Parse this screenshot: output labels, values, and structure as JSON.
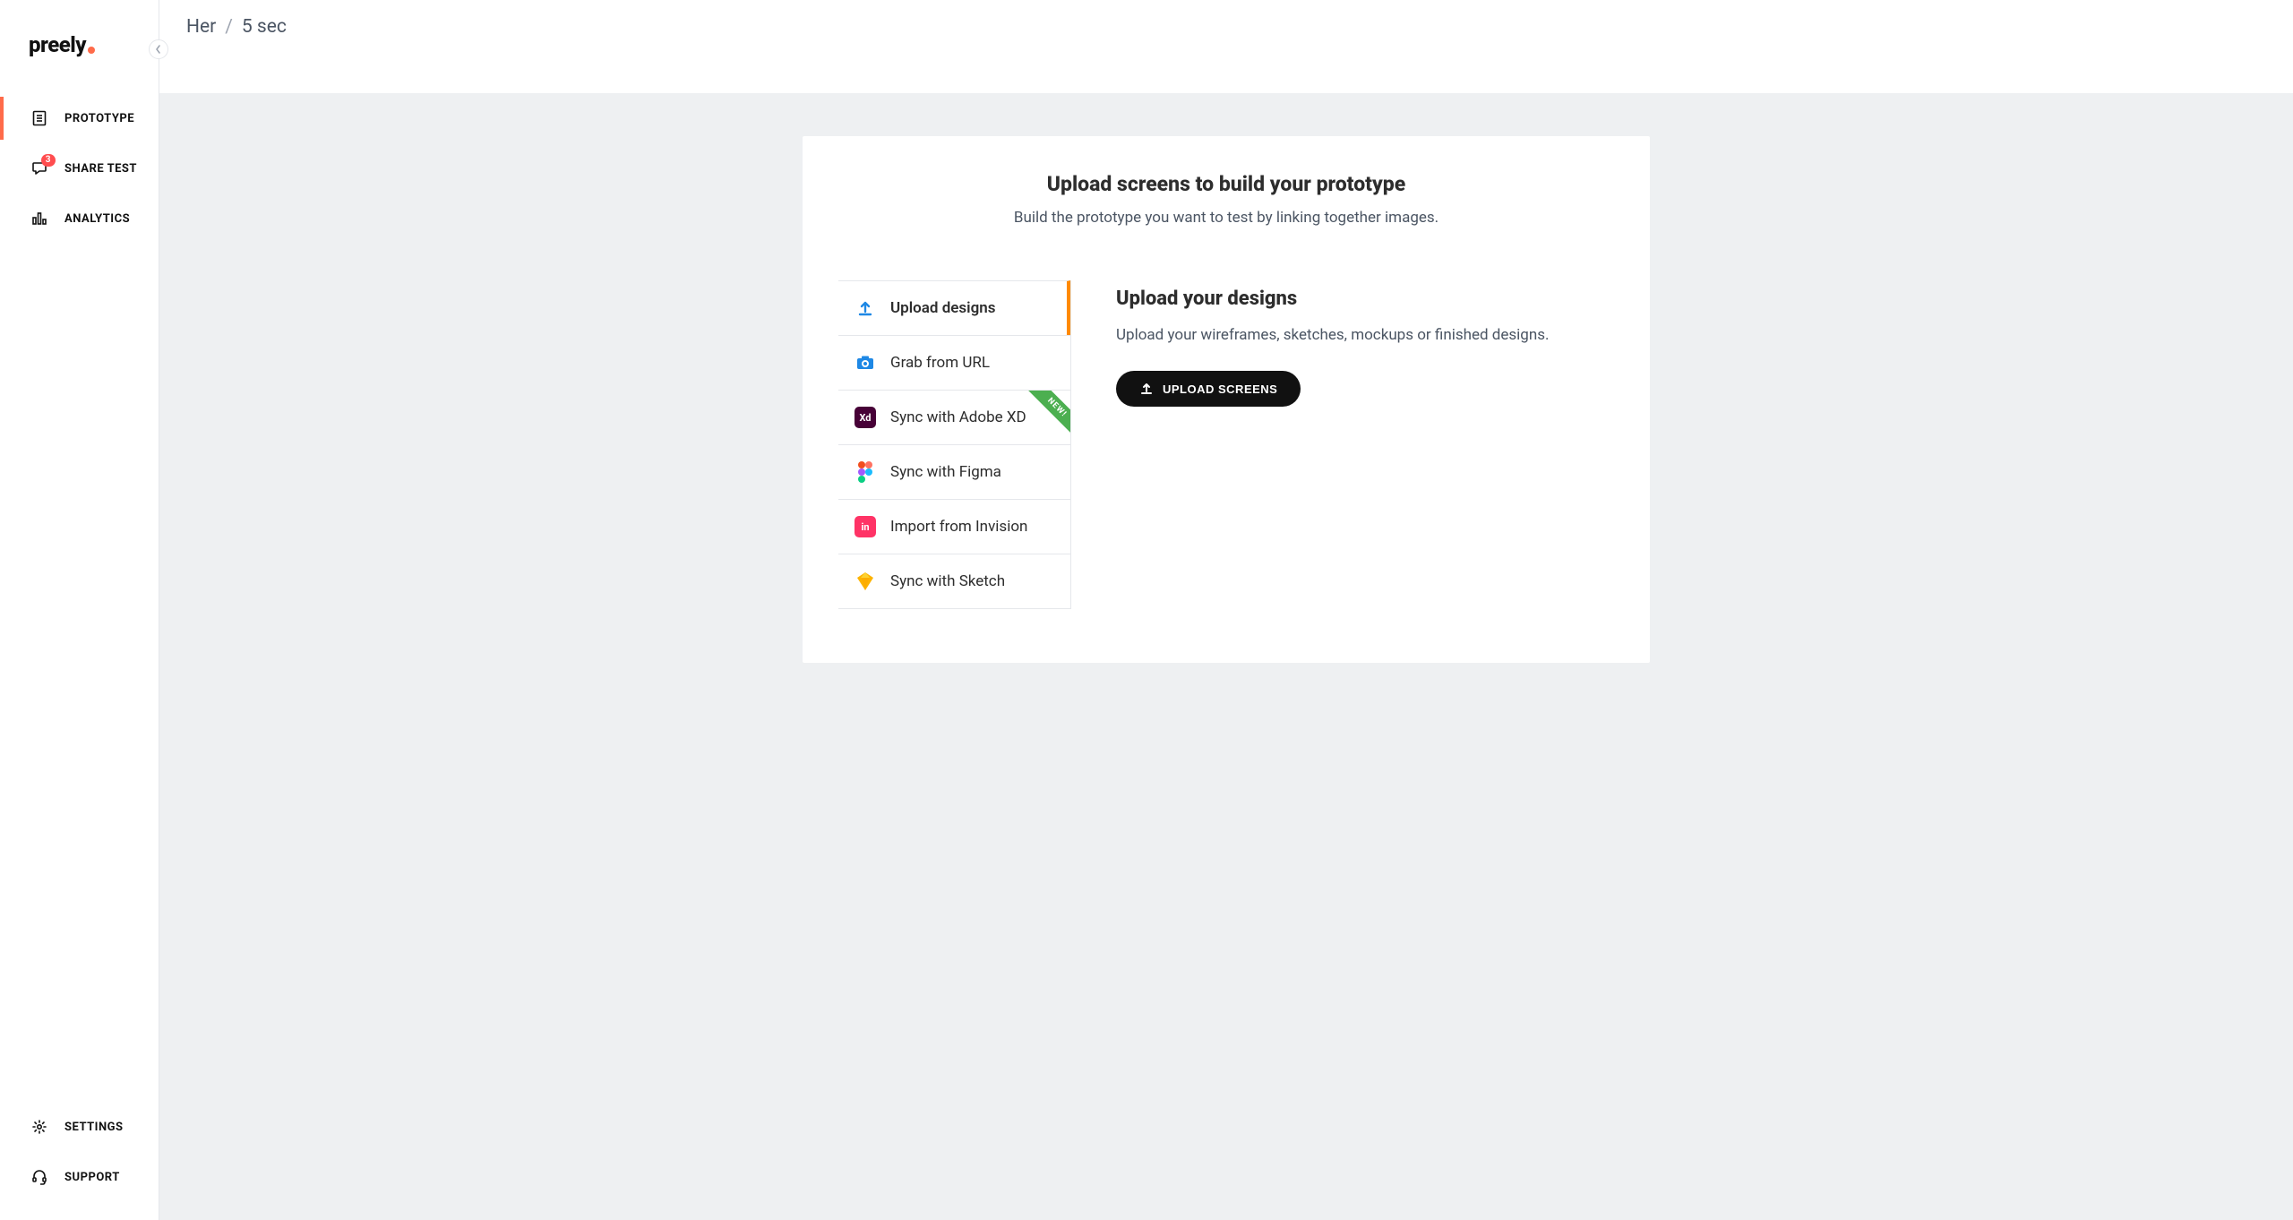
{
  "brand": {
    "name": "preely"
  },
  "sidebar": {
    "items": [
      {
        "label": "PROTOTYPE",
        "icon": "document-icon",
        "active": true
      },
      {
        "label": "SHARE TEST",
        "icon": "chat-icon",
        "badge": "3"
      },
      {
        "label": "ANALYTICS",
        "icon": "analytics-icon"
      }
    ],
    "bottom": [
      {
        "label": "SETTINGS",
        "icon": "gear-icon"
      },
      {
        "label": "SUPPORT",
        "icon": "headset-icon"
      }
    ]
  },
  "breadcrumb": {
    "parent": "Her",
    "sep": "/",
    "current": "5 sec"
  },
  "card": {
    "title": "Upload screens to build your prototype",
    "subtitle": "Build the prototype you want to test by linking together images."
  },
  "options": [
    {
      "label": "Upload designs",
      "icon": "upload-blue-icon",
      "active": true
    },
    {
      "label": "Grab from URL",
      "icon": "camera-icon"
    },
    {
      "label": "Sync with Adobe XD",
      "icon": "adobe-xd-icon",
      "ribbon": "NEW!"
    },
    {
      "label": "Sync with Figma",
      "icon": "figma-icon"
    },
    {
      "label": "Import from Invision",
      "icon": "invision-icon"
    },
    {
      "label": "Sync with Sketch",
      "icon": "sketch-icon"
    }
  ],
  "detail": {
    "title": "Upload your designs",
    "text": "Upload your wireframes, sketches, mockups or finished designs.",
    "button": "UPLOAD SCREENS"
  }
}
